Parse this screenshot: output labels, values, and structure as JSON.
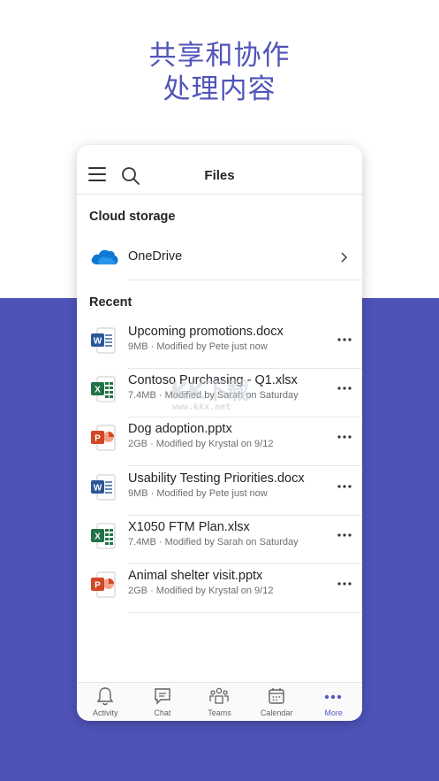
{
  "headline": {
    "line1": "共享和协作",
    "line2": "处理内容"
  },
  "header": {
    "title": "Files"
  },
  "cloud_storage": {
    "section_title": "Cloud storage",
    "items": [
      {
        "label": "OneDrive",
        "icon": "onedrive-cloud-icon"
      }
    ]
  },
  "recent": {
    "section_title": "Recent",
    "files": [
      {
        "name": "Upcoming promotions.docx",
        "meta": "9MB · Modified by Pete just now",
        "type": "word"
      },
      {
        "name": "Contoso Purchasing - Q1.xlsx",
        "meta": "7.4MB · Modified by Sarah on Saturday",
        "type": "excel"
      },
      {
        "name": "Dog adoption.pptx",
        "meta": "2GB · Modified by Krystal on 9/12",
        "type": "powerpoint"
      },
      {
        "name": "Usability Testing Priorities.docx",
        "meta": "9MB · Modified by Pete just now",
        "type": "word"
      },
      {
        "name": "X1050 FTM Plan.xlsx",
        "meta": "7.4MB · Modified by Sarah on Saturday",
        "type": "excel"
      },
      {
        "name": "Animal shelter visit.pptx",
        "meta": "2GB · Modified by Krystal on 9/12",
        "type": "powerpoint"
      }
    ]
  },
  "tabs": [
    {
      "label": "Activity",
      "icon": "bell-icon"
    },
    {
      "label": "Chat",
      "icon": "chat-icon"
    },
    {
      "label": "Teams",
      "icon": "teams-icon"
    },
    {
      "label": "Calendar",
      "icon": "calendar-icon"
    },
    {
      "label": "More",
      "icon": "more-icon",
      "active": true
    }
  ],
  "watermark": {
    "big": "KK下载",
    "small": "www.kkx.net"
  },
  "colors": {
    "brand": "#4f53b8",
    "headline": "#5055b8",
    "active_tab": "#5559c2",
    "word": "#2b579a",
    "excel": "#217346",
    "powerpoint": "#d24726",
    "onedrive": "#0f78d4"
  }
}
